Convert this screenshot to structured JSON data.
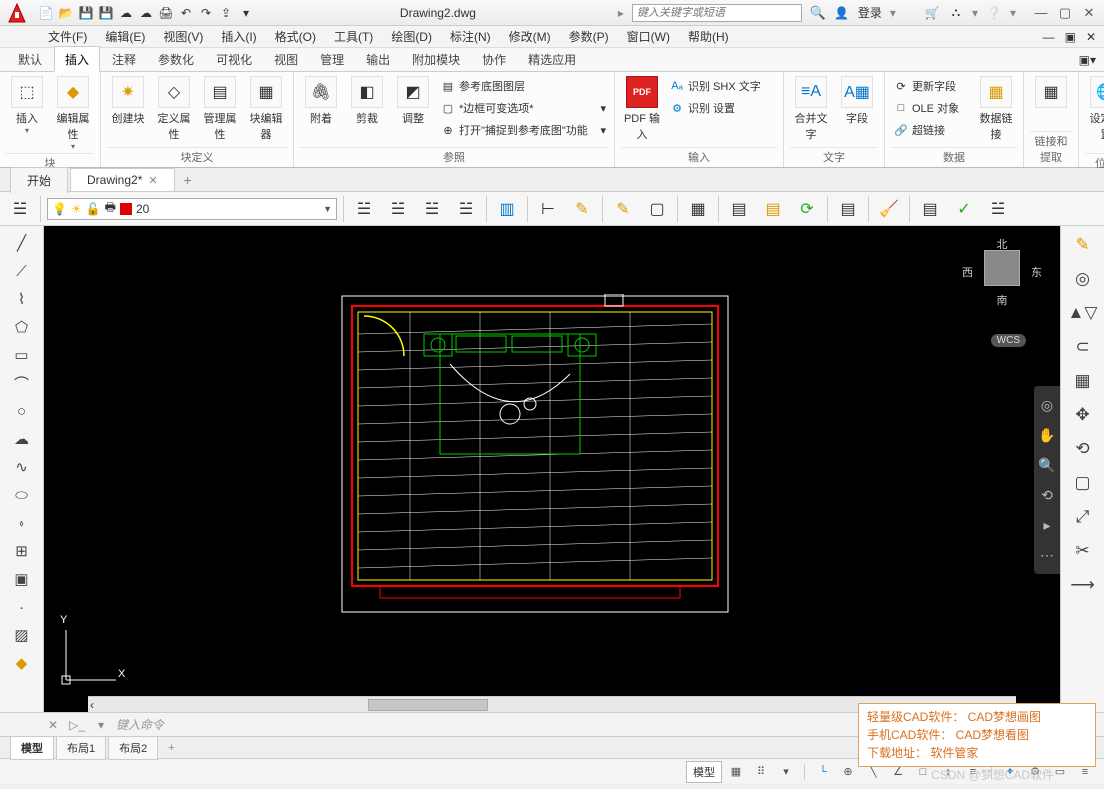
{
  "title": {
    "filename": "Drawing2.dwg",
    "search_placeholder": "键入关键字或短语",
    "login": "登录"
  },
  "menu": {
    "file": "文件(F)",
    "edit": "编辑(E)",
    "view": "视图(V)",
    "insert": "插入(I)",
    "format": "格式(O)",
    "tools": "工具(T)",
    "draw": "绘图(D)",
    "annotate": "标注(N)",
    "modify": "修改(M)",
    "param": "参数(P)",
    "window": "窗口(W)",
    "help": "帮助(H)"
  },
  "ribtabs": {
    "t0": "默认",
    "t1": "插入",
    "t2": "注释",
    "t3": "参数化",
    "t4": "可视化",
    "t5": "视图",
    "t6": "管理",
    "t7": "输出",
    "t8": "附加模块",
    "t9": "协作",
    "t10": "精选应用"
  },
  "ribbon": {
    "block": {
      "insert": "插入",
      "edit": "编辑属性",
      "panel": "块"
    },
    "blockdef": {
      "create": "创建块",
      "defattr": "定义属性",
      "mgrattr": "管理属性",
      "editor": "块编辑器",
      "panel": "块定义"
    },
    "ref": {
      "attach": "附着",
      "clip": "剪裁",
      "adjust": "调整",
      "underlay": "参考底图图层",
      "frame": "*边框可变选项*",
      "snap": "打开\"捕捉到参考底图\"功能",
      "panel": "参照"
    },
    "import": {
      "pdf": "PDF 输入",
      "shx": "识别 SHX 文字",
      "set": "识别 设置",
      "panel": "输入"
    },
    "text": {
      "merge": "合并文字",
      "field": "字段",
      "panel": "文字"
    },
    "data": {
      "upd": "更新字段",
      "ole": "OLE 对象",
      "link": "超链接",
      "datalink": "数据链接",
      "panel": "数据"
    },
    "link": {
      "panel": "链接和提取"
    },
    "loc": {
      "setloc": "设定位置",
      "panel": "位置"
    }
  },
  "filetabs": {
    "t0": "开始",
    "t1": "Drawing2*"
  },
  "layer": {
    "name": "20"
  },
  "viewcube": {
    "n": "北",
    "s": "南",
    "e": "东",
    "w": "西",
    "wcs": "WCS"
  },
  "ucs": {
    "x": "X",
    "y": "Y"
  },
  "cmd": {
    "placeholder": "键入命令"
  },
  "layouts": {
    "model": "模型",
    "l1": "布局1",
    "l2": "布局2"
  },
  "status": {
    "model": "模型"
  },
  "ad": {
    "l1": "轻量级CAD软件： CAD梦想画图",
    "l2": "手机CAD软件：  CAD梦想看图",
    "l3": "下载地址：   软件管家"
  },
  "watermark": "CSDN @梦想CAD软件"
}
